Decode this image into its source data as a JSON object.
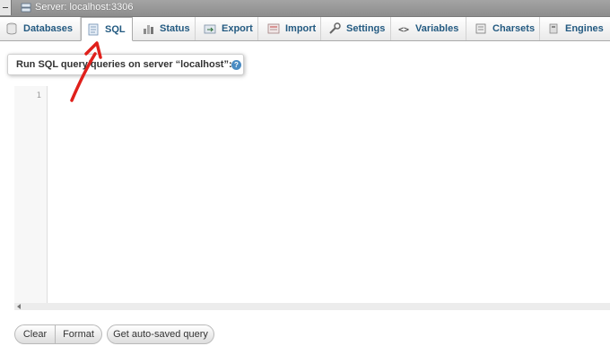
{
  "server_bar": {
    "label": "Server: localhost:3306"
  },
  "tabs": [
    {
      "label": "Databases",
      "icon": "database-icon",
      "active": false
    },
    {
      "label": "SQL",
      "icon": "sql-icon",
      "active": true
    },
    {
      "label": "Status",
      "icon": "status-icon",
      "active": false
    },
    {
      "label": "Export",
      "icon": "export-icon",
      "active": false
    },
    {
      "label": "Import",
      "icon": "import-icon",
      "active": false
    },
    {
      "label": "Settings",
      "icon": "wrench-icon",
      "active": false
    },
    {
      "label": "Variables",
      "icon": "variables-icon",
      "active": false
    },
    {
      "label": "Charsets",
      "icon": "charsets-icon",
      "active": false
    },
    {
      "label": "Engines",
      "icon": "engines-icon",
      "active": false
    }
  ],
  "query": {
    "legend": "Run SQL query/queries on server “localhost”:",
    "help_glyph": "?"
  },
  "editor": {
    "line_numbers": [
      "1"
    ]
  },
  "buttons": {
    "clear": "Clear",
    "format": "Format",
    "autosave": "Get auto-saved query"
  },
  "colors": {
    "tab_text": "#235a81",
    "annotation": "#e0201b",
    "titlebar": "#9a9a9a"
  }
}
